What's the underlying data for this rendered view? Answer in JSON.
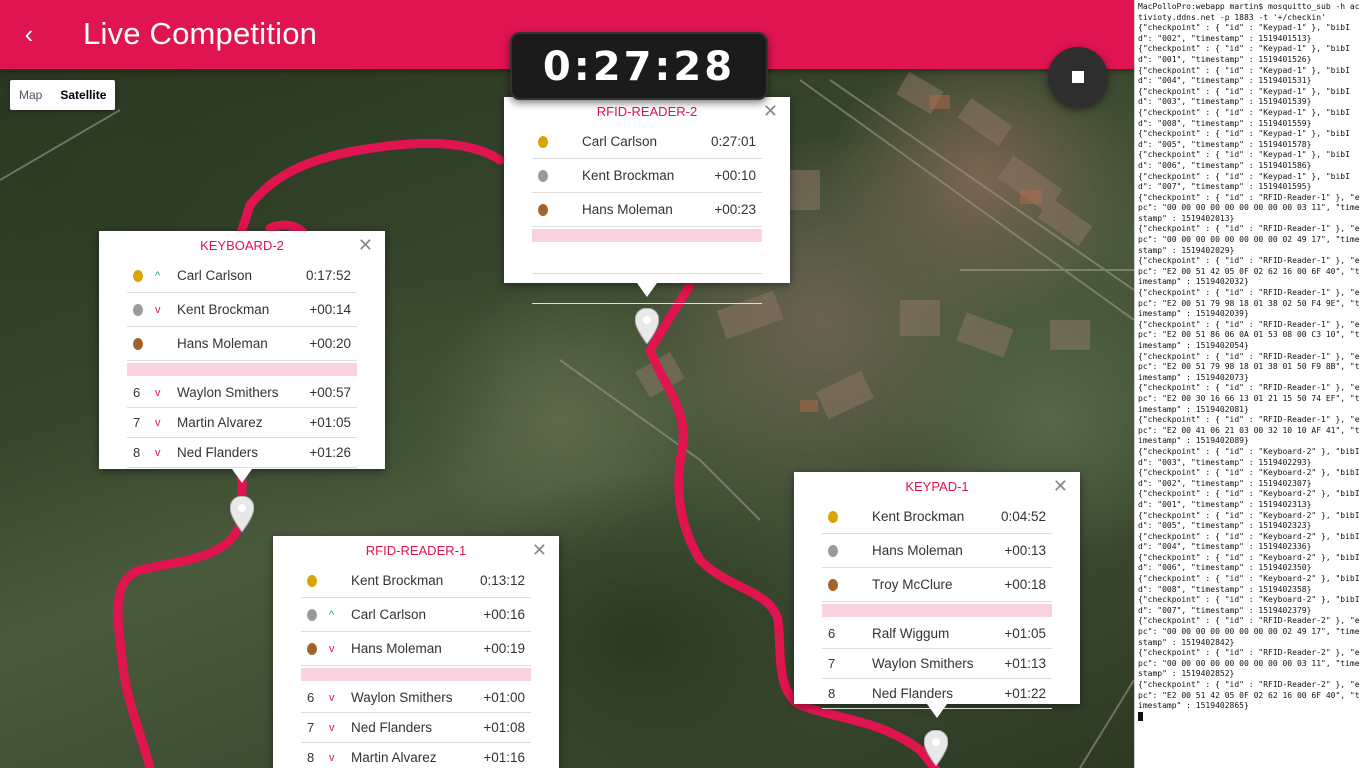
{
  "header": {
    "title": "Live Competition",
    "back_icon": "back-arrow-icon"
  },
  "timer": {
    "value": "0:27:28"
  },
  "stop_button": {
    "icon": "stop-icon"
  },
  "map_type": {
    "options": [
      "Map",
      "Satellite"
    ],
    "selected": "Satellite"
  },
  "colors": {
    "accent": "#e0144f",
    "route": "#e0144f"
  },
  "checkpoints": {
    "keyboard2": {
      "title": "KEYBOARD-2",
      "top": [
        {
          "medal": "gold",
          "trend": "up",
          "name": "Carl Carlson",
          "time": "0:17:52"
        },
        {
          "medal": "silver",
          "trend": "down",
          "name": "Kent Brockman",
          "time": "+00:14"
        },
        {
          "medal": "bronze",
          "trend": "",
          "name": "Hans Moleman",
          "time": "+00:20"
        }
      ],
      "rest": [
        {
          "pos": "6",
          "trend": "down",
          "name": "Waylon Smithers",
          "time": "+00:57"
        },
        {
          "pos": "7",
          "trend": "down",
          "name": "Martin Alvarez",
          "time": "+01:05"
        },
        {
          "pos": "8",
          "trend": "down",
          "name": "Ned Flanders",
          "time": "+01:26"
        }
      ]
    },
    "rfid2": {
      "title": "RFID-READER-2",
      "top": [
        {
          "medal": "gold",
          "trend": "",
          "name": "Carl Carlson",
          "time": "0:27:01"
        },
        {
          "medal": "silver",
          "trend": "",
          "name": "Kent Brockman",
          "time": "+00:10"
        },
        {
          "medal": "bronze",
          "trend": "",
          "name": "Hans Moleman",
          "time": "+00:23"
        }
      ]
    },
    "rfid1": {
      "title": "RFID-READER-1",
      "top": [
        {
          "medal": "gold",
          "trend": "",
          "name": "Kent Brockman",
          "time": "0:13:12"
        },
        {
          "medal": "silver",
          "trend": "up",
          "name": "Carl Carlson",
          "time": "+00:16"
        },
        {
          "medal": "bronze",
          "trend": "down",
          "name": "Hans Moleman",
          "time": "+00:19"
        }
      ],
      "rest": [
        {
          "pos": "6",
          "trend": "down",
          "name": "Waylon Smithers",
          "time": "+01:00"
        },
        {
          "pos": "7",
          "trend": "down",
          "name": "Ned Flanders",
          "time": "+01:08"
        },
        {
          "pos": "8",
          "trend": "down",
          "name": "Martin Alvarez",
          "time": "+01:16"
        }
      ]
    },
    "keypad1": {
      "title": "KEYPAD-1",
      "top": [
        {
          "medal": "gold",
          "trend": "",
          "name": "Kent Brockman",
          "time": "0:04:52"
        },
        {
          "medal": "silver",
          "trend": "",
          "name": "Hans Moleman",
          "time": "+00:13"
        },
        {
          "medal": "bronze",
          "trend": "",
          "name": "Troy McClure",
          "time": "+00:18"
        }
      ],
      "rest": [
        {
          "pos": "6",
          "trend": "",
          "name": "Ralf Wiggum",
          "time": "+01:05"
        },
        {
          "pos": "7",
          "trend": "",
          "name": "Waylon Smithers",
          "time": "+01:13"
        },
        {
          "pos": "8",
          "trend": "",
          "name": "Ned Flanders",
          "time": "+01:22"
        }
      ]
    }
  },
  "terminal": {
    "lines": [
      "MacPolloPro:webapp martin$ mosquitto_sub -h activioty.ddns.net -p 1883 -t '+/checkin'",
      "{\"checkpoint\" : { \"id\" : \"Keypad-1\" }, \"bibId\": \"002\", \"timestamp\" : 1519401513}",
      "{\"checkpoint\" : { \"id\" : \"Keypad-1\" }, \"bibId\": \"001\", \"timestamp\" : 1519401526}",
      "{\"checkpoint\" : { \"id\" : \"Keypad-1\" }, \"bibId\": \"004\", \"timestamp\" : 1519401531}",
      "{\"checkpoint\" : { \"id\" : \"Keypad-1\" }, \"bibId\": \"003\", \"timestamp\" : 1519401539}",
      "{\"checkpoint\" : { \"id\" : \"Keypad-1\" }, \"bibId\": \"008\", \"timestamp\" : 1519401559}",
      "{\"checkpoint\" : { \"id\" : \"Keypad-1\" }, \"bibId\": \"005\", \"timestamp\" : 1519401578}",
      "{\"checkpoint\" : { \"id\" : \"Keypad-1\" }, \"bibId\": \"006\", \"timestamp\" : 1519401586}",
      "{\"checkpoint\" : { \"id\" : \"Keypad-1\" }, \"bibId\": \"007\", \"timestamp\" : 1519401595}",
      "{\"checkpoint\" : { \"id\" : \"RFID-Reader-1\" }, \"epc\": \"00 00 00 00 00 00 00 00 00 03 11\", \"timestamp\" : 1519402013}",
      "{\"checkpoint\" : { \"id\" : \"RFID-Reader-1\" }, \"epc\": \"00 00 00 00 00 00 00 00 02 49 17\", \"timestamp\" : 1519402029}",
      "{\"checkpoint\" : { \"id\" : \"RFID-Reader-1\" }, \"epc\": \"E2 00 51 42 05 0F 02 62 16 00 6F 40\", \"timestamp\" : 1519402032}",
      "{\"checkpoint\" : { \"id\" : \"RFID-Reader-1\" }, \"epc\": \"E2 00 51 79 98 18 01 38 02 50 F4 9E\", \"timestamp\" : 1519402039}",
      "{\"checkpoint\" : { \"id\" : \"RFID-Reader-1\" }, \"epc\": \"E2 00 51 86 06 0A 01 53 08 00 C3 10\", \"timestamp\" : 1519402054}",
      "{\"checkpoint\" : { \"id\" : \"RFID-Reader-1\" }, \"epc\": \"E2 00 51 79 98 18 01 38 01 50 F9 8B\", \"timestamp\" : 1519402073}",
      "{\"checkpoint\" : { \"id\" : \"RFID-Reader-1\" }, \"epc\": \"E2 00 30 16 66 13 01 21 15 50 74 EF\", \"timestamp\" : 1519402081}",
      "{\"checkpoint\" : { \"id\" : \"RFID-Reader-1\" }, \"epc\": \"E2 00 41 06 21 03 00 32 10 10 AF 41\", \"timestamp\" : 1519402089}",
      "{\"checkpoint\" : { \"id\" : \"Keyboard-2\" }, \"bibId\": \"003\", \"timestamp\" : 1519402293}",
      "{\"checkpoint\" : { \"id\" : \"Keyboard-2\" }, \"bibId\": \"002\", \"timestamp\" : 1519402307}",
      "{\"checkpoint\" : { \"id\" : \"Keyboard-2\" }, \"bibId\": \"001\", \"timestamp\" : 1519402313}",
      "{\"checkpoint\" : { \"id\" : \"Keyboard-2\" }, \"bibId\": \"005\", \"timestamp\" : 1519402323}",
      "{\"checkpoint\" : { \"id\" : \"Keyboard-2\" }, \"bibId\": \"004\", \"timestamp\" : 1519402336}",
      "{\"checkpoint\" : { \"id\" : \"Keyboard-2\" }, \"bibId\": \"006\", \"timestamp\" : 1519402350}",
      "{\"checkpoint\" : { \"id\" : \"Keyboard-2\" }, \"bibId\": \"008\", \"timestamp\" : 1519402358}",
      "{\"checkpoint\" : { \"id\" : \"Keyboard-2\" }, \"bibId\": \"007\", \"timestamp\" : 1519402379}",
      "{\"checkpoint\" : { \"id\" : \"RFID-Reader-2\" }, \"epc\": \"00 00 00 00 00 00 00 00 02 49 17\", \"timestamp\" : 1519402842}",
      "{\"checkpoint\" : { \"id\" : \"RFID-Reader-2\" }, \"epc\": \"00 00 00 00 00 00 00 00 00 03 11\", \"timestamp\" : 1519402852}",
      "{\"checkpoint\" : { \"id\" : \"RFID-Reader-2\" }, \"epc\": \"E2 00 51 42 05 0F 02 62 16 00 6F 40\", \"timestamp\" : 1519402865}"
    ]
  }
}
